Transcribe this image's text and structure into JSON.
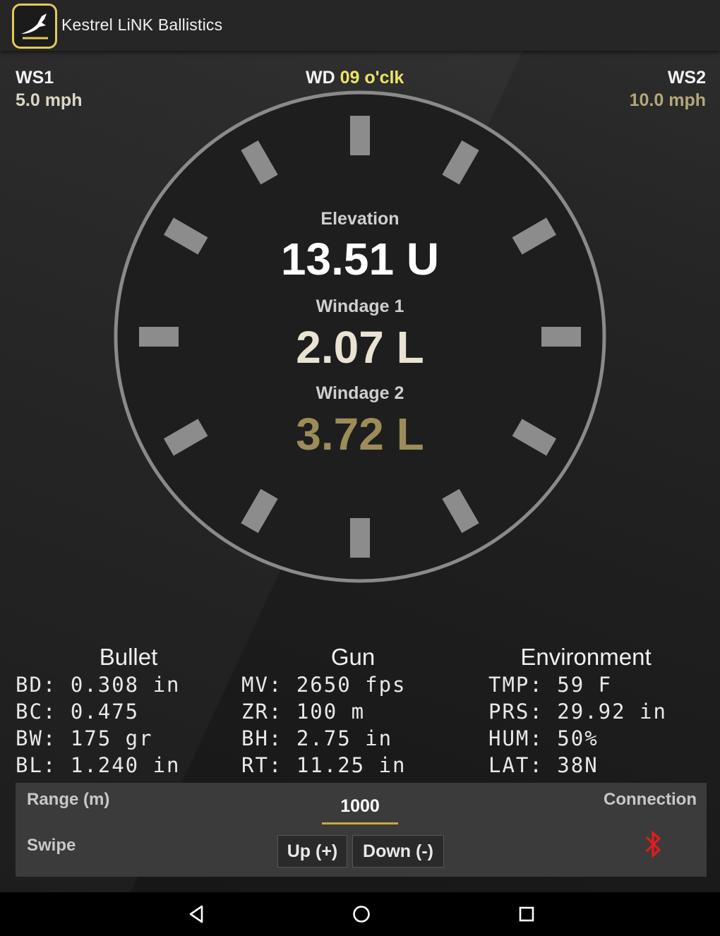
{
  "app": {
    "title": "Kestrel LiNK Ballistics",
    "logo_icon": "kestrel-bird-icon"
  },
  "wind": {
    "ws1_label": "WS1",
    "ws1_value": "5.0 mph",
    "wd_label": "WD",
    "wd_value": "09 o'clk",
    "ws2_label": "WS2",
    "ws2_value": "10.0 mph"
  },
  "solution": {
    "elevation_label": "Elevation",
    "elevation_value": "13.51 U",
    "windage1_label": "Windage 1",
    "windage1_value": "2.07 L",
    "windage2_label": "Windage 2",
    "windage2_value": "3.72 L"
  },
  "bullet": {
    "title": "Bullet",
    "lines": [
      "BD: 0.308 in",
      "BC: 0.475",
      "BW: 175 gr",
      "BL: 1.240 in"
    ]
  },
  "gun": {
    "title": "Gun",
    "lines": [
      "MV: 2650 fps",
      "ZR: 100 m",
      "BH: 2.75 in",
      "RT: 11.25 in"
    ]
  },
  "environment": {
    "title": "Environment",
    "lines": [
      "TMP: 59 F",
      "PRS: 29.92 in",
      "HUM: 50%",
      "LAT: 38N"
    ]
  },
  "controls": {
    "range_label": "Range (m)",
    "range_value": "1000",
    "swipe_label": "Swipe",
    "up_label": "Up (+)",
    "down_label": "Down (-)",
    "connection_label": "Connection",
    "connection_icon": "bluetooth-icon",
    "connection_color": "#e31c1c"
  },
  "nav": {
    "back_icon": "back-icon",
    "home_icon": "home-icon",
    "recents_icon": "recents-icon"
  },
  "colors": {
    "accent": "#e3c95a",
    "ws2": "#b5a77a",
    "wd": "#ece36a",
    "windage2": "#9b8c5a"
  }
}
